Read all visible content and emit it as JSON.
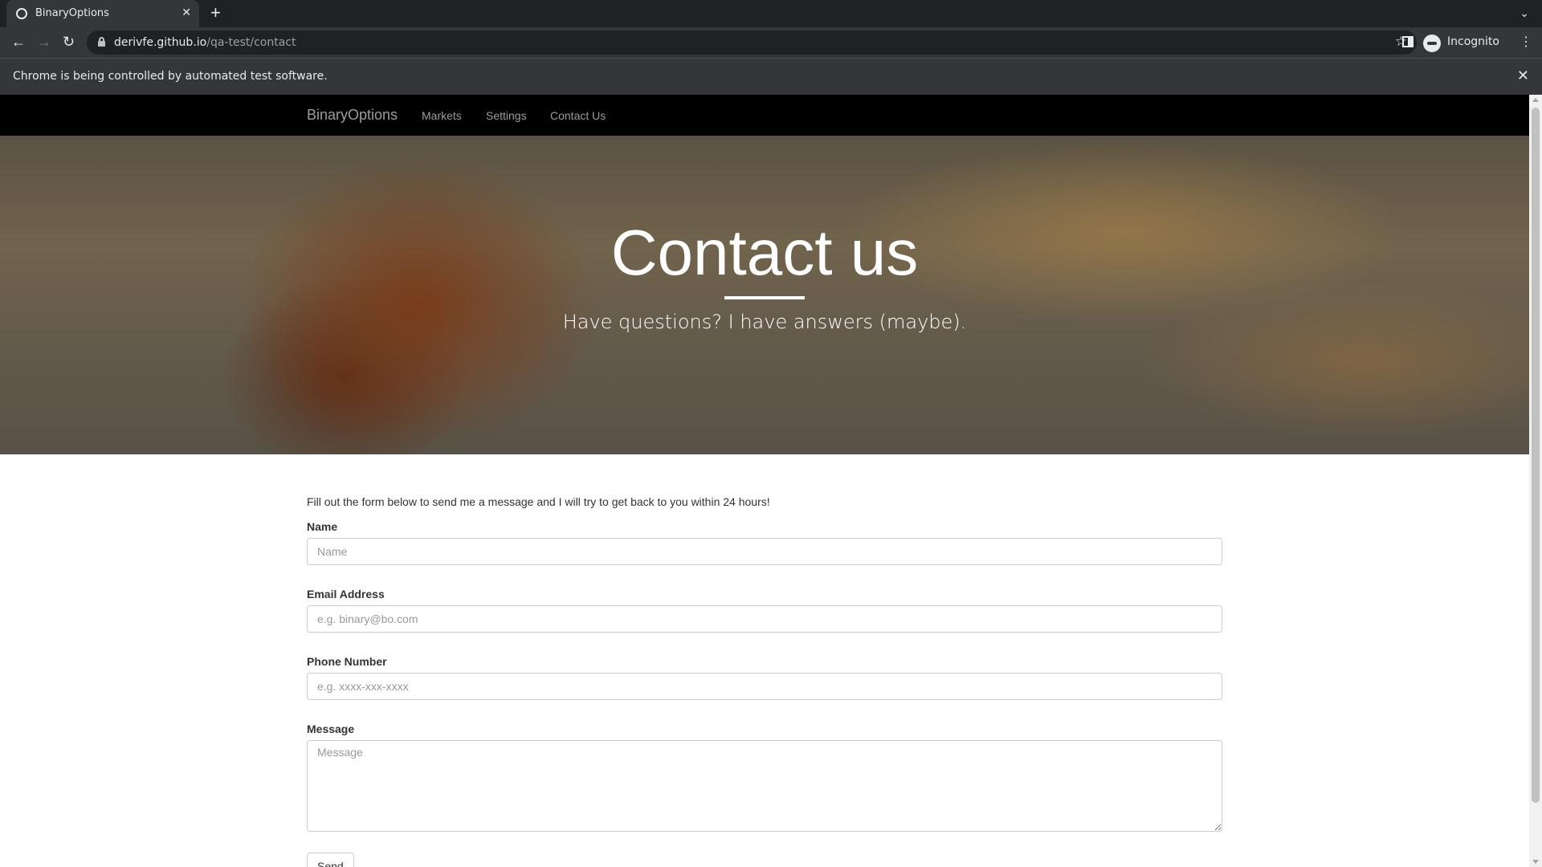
{
  "browser": {
    "tab_title": "BinaryOptions",
    "url_host": "derivfe.github.io",
    "url_path": "/qa-test/contact",
    "profile_label": "Incognito",
    "infobar_message": "Chrome is being controlled by automated test software."
  },
  "nav": {
    "brand": "BinaryOptions",
    "links": [
      "Markets",
      "Settings",
      "Contact Us"
    ]
  },
  "hero": {
    "title": "Contact us",
    "subtitle": "Have questions? I have answers (maybe)."
  },
  "form": {
    "intro": "Fill out the form below to send me a message and I will try to get back to you within 24 hours!",
    "name_label": "Name",
    "name_placeholder": "Name",
    "name_value": "",
    "email_label": "Email Address",
    "email_placeholder": "e.g. binary@bo.com",
    "email_value": "",
    "phone_label": "Phone Number",
    "phone_placeholder": "e.g. xxxx-xxx-xxxx",
    "phone_value": "",
    "message_label": "Message",
    "message_placeholder": "Message",
    "message_value": "",
    "send_label": "Send"
  },
  "icons": {
    "favicon": "globe-icon",
    "tab_close": "close-icon",
    "new_tab": "plus-icon",
    "back": "arrow-left-icon",
    "forward": "arrow-right-icon",
    "reload": "reload-icon",
    "lock": "lock-icon",
    "bookmark": "star-icon",
    "side_panel": "side-panel-icon",
    "incognito": "incognito-icon",
    "menu": "kebab-menu-icon"
  }
}
